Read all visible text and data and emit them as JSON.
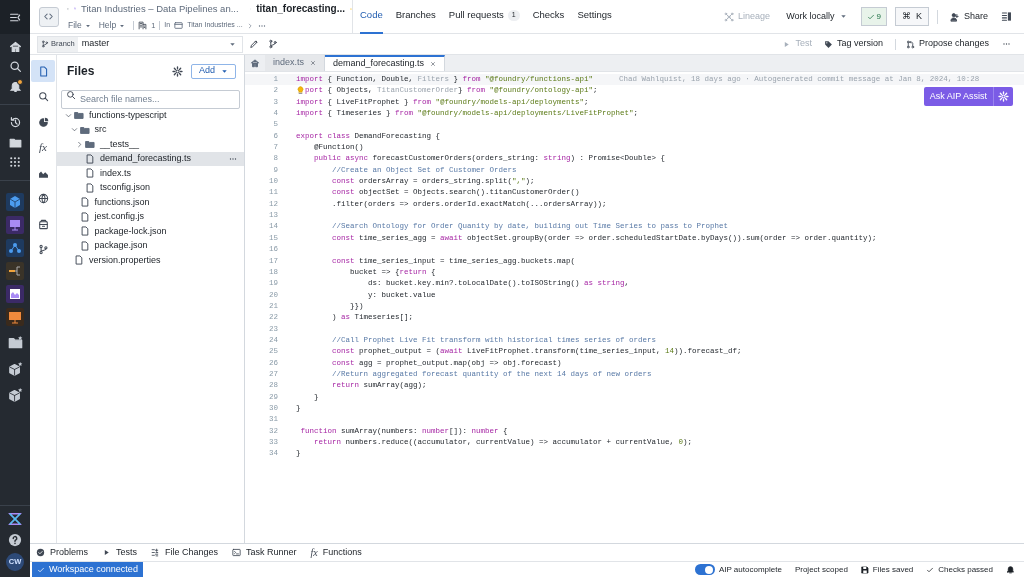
{
  "nav_rail": {
    "unread_notifications": true,
    "user_initials": "CW"
  },
  "header": {
    "breadcrumb_parent": "Titan Industries – Data Pipelines an...",
    "file_title": "titan_forecasting...",
    "starred": true,
    "menus": [
      "File",
      "Help"
    ],
    "resource_count": "1",
    "location_prefix": "In",
    "location": "Titan Industries ..."
  },
  "nav_tabs": [
    {
      "label": "Code",
      "selected": true
    },
    {
      "label": "Branches",
      "selected": false
    },
    {
      "label": "Pull requests",
      "count": "1",
      "selected": false
    },
    {
      "label": "Checks",
      "selected": false
    },
    {
      "label": "Settings",
      "selected": false
    }
  ],
  "header_actions": {
    "lineage": {
      "label": "Lineage",
      "disabled": true
    },
    "work_locally": "Work locally",
    "checks_count": "9",
    "shortcut": {
      "symbol": "⌘",
      "key": "K"
    },
    "share": "Share"
  },
  "branch": {
    "label": "Branch",
    "value": "master"
  },
  "toolbar": [
    {
      "kind": "test",
      "label": "Test",
      "disabled": true
    },
    {
      "kind": "tag",
      "label": "Tag version",
      "disabled": false
    },
    {
      "kind": "propose",
      "label": "Propose changes",
      "disabled": false
    }
  ],
  "side_icons": [
    {
      "kind": "files",
      "selected": true
    },
    {
      "kind": "search",
      "selected": false
    },
    {
      "kind": "pie",
      "selected": false
    },
    {
      "kind": "fx",
      "symbol": "fx",
      "selected": false
    },
    {
      "kind": "chart",
      "selected": false
    },
    {
      "kind": "globe",
      "selected": false
    },
    {
      "kind": "package",
      "selected": false
    },
    {
      "kind": "branch",
      "selected": false
    }
  ],
  "files": {
    "title": "Files",
    "add_button": "Add",
    "search_placeholder": "Search file names...",
    "tree": [
      {
        "name": "functions-typescript",
        "kind": "folder",
        "expanded": true,
        "selected": false,
        "children": [
          {
            "name": "src",
            "kind": "folder",
            "expanded": true,
            "selected": false,
            "children": [
              {
                "name": "__tests__",
                "kind": "folder",
                "expanded": false,
                "selected": false
              },
              {
                "name": "demand_forecasting.ts",
                "kind": "file",
                "selected": true
              },
              {
                "name": "index.ts",
                "kind": "file",
                "selected": false
              },
              {
                "name": "tsconfig.json",
                "kind": "file",
                "selected": false
              }
            ]
          },
          {
            "name": "functions.json",
            "kind": "file",
            "selected": false
          },
          {
            "name": "jest.config.js",
            "kind": "file",
            "selected": false
          },
          {
            "name": "package-lock.json",
            "kind": "file",
            "selected": false
          },
          {
            "name": "package.json",
            "kind": "file",
            "selected": false
          }
        ]
      },
      {
        "name": "version.properties",
        "kind": "file",
        "selected": false
      }
    ]
  },
  "editor": {
    "tabs": [
      {
        "label": "index.ts",
        "selected": false
      },
      {
        "label": "demand_forecasting.ts",
        "selected": true
      }
    ],
    "blame": "Chad Wahlquist, 18 days ago · Autogenerated commit message at Jan 8, 2024, 10:28",
    "ai_button": "Ask AIP Assist",
    "lines": [
      {
        "number": "1",
        "current": true,
        "hint": false,
        "tokens": [
          {
            "kind": "kw",
            "text": "import"
          },
          {
            "kind": "plain",
            "text": " { Function, Double, "
          },
          {
            "kind": "dim",
            "text": "Filters"
          },
          {
            "kind": "plain",
            "text": " } "
          },
          {
            "kind": "kw",
            "text": "from "
          },
          {
            "kind": "str",
            "text": "\"@foundry/functions-api\""
          }
        ]
      },
      {
        "number": "2",
        "current": false,
        "hint": true,
        "tokens": [
          {
            "kind": "kw",
            "text": "port"
          },
          {
            "kind": "plain",
            "text": " { Objects, "
          },
          {
            "kind": "dim",
            "text": "TitanCustomerOrder"
          },
          {
            "kind": "plain",
            "text": "} "
          },
          {
            "kind": "kw",
            "text": "from "
          },
          {
            "kind": "str",
            "text": "\"@foundry/ontology-api\""
          },
          {
            "kind": "plain",
            "text": ";"
          }
        ]
      },
      {
        "number": "3",
        "current": false,
        "hint": false,
        "tokens": [
          {
            "kind": "kw",
            "text": "import"
          },
          {
            "kind": "plain",
            "text": " { LiveFitProphet } "
          },
          {
            "kind": "kw",
            "text": "from "
          },
          {
            "kind": "str",
            "text": "\"@foundry/models-api/deployments\""
          },
          {
            "kind": "plain",
            "text": ";"
          }
        ]
      },
      {
        "number": "4",
        "current": false,
        "hint": false,
        "tokens": [
          {
            "kind": "kw",
            "text": "import"
          },
          {
            "kind": "plain",
            "text": " { Timeseries } "
          },
          {
            "kind": "kw",
            "text": "from "
          },
          {
            "kind": "str",
            "text": "\"@foundry/models-api/deployments/LiveFitProphet\""
          },
          {
            "kind": "plain",
            "text": ";"
          }
        ]
      },
      {
        "number": "5",
        "current": false,
        "hint": false
      },
      {
        "number": "6",
        "current": false,
        "hint": false,
        "tokens": [
          {
            "kind": "kw",
            "text": "export class"
          },
          {
            "kind": "plain",
            "text": " DemandForecasting {"
          }
        ]
      },
      {
        "number": "7",
        "current": false,
        "hint": false,
        "tokens": [
          {
            "kind": "plain",
            "text": "    @Function()"
          }
        ]
      },
      {
        "number": "8",
        "current": false,
        "hint": false,
        "tokens": [
          {
            "kind": "kw",
            "text": "    public async"
          },
          {
            "kind": "plain",
            "text": " forecastCustomerOrders(orders_string: "
          },
          {
            "kind": "kw",
            "text": "string"
          },
          {
            "kind": "plain",
            "text": ") : Promise<Double> {"
          }
        ]
      },
      {
        "number": "9",
        "current": false,
        "hint": false,
        "tokens": [
          {
            "kind": "cm",
            "text": "        //Create an Object Set of Customer Orders"
          }
        ]
      },
      {
        "number": "10",
        "current": false,
        "hint": false,
        "tokens": [
          {
            "kind": "kw",
            "text": "        const"
          },
          {
            "kind": "plain",
            "text": " ordersArray = orders_string.split("
          },
          {
            "kind": "str",
            "text": "\",\""
          },
          {
            "kind": "plain",
            "text": ");"
          }
        ]
      },
      {
        "number": "11",
        "current": false,
        "hint": false,
        "tokens": [
          {
            "kind": "kw",
            "text": "        const"
          },
          {
            "kind": "plain",
            "text": " objectSet = Objects.search().titanCustomerOrder()"
          }
        ]
      },
      {
        "number": "12",
        "current": false,
        "hint": false,
        "tokens": [
          {
            "kind": "plain",
            "text": "        .filter(orders => orders.orderId.exactMatch(...ordersArray));"
          }
        ]
      },
      {
        "number": "13",
        "current": false,
        "hint": false
      },
      {
        "number": "14",
        "current": false,
        "hint": false,
        "tokens": [
          {
            "kind": "cm",
            "text": "        //Search Ontology for Order Quanity by date, building out Time Series to pass to Prophet"
          }
        ]
      },
      {
        "number": "15",
        "current": false,
        "hint": false,
        "tokens": [
          {
            "kind": "kw",
            "text": "        const"
          },
          {
            "kind": "plain",
            "text": " time_series_agg = "
          },
          {
            "kind": "kw",
            "text": "await"
          },
          {
            "kind": "plain",
            "text": " objectSet.groupBy(order => order.scheduledStartDate.byDays()).sum(order => order.quantity);"
          }
        ]
      },
      {
        "number": "16",
        "current": false,
        "hint": false
      },
      {
        "number": "17",
        "current": false,
        "hint": false,
        "tokens": [
          {
            "kind": "kw",
            "text": "        const"
          },
          {
            "kind": "plain",
            "text": " time_series_input = time_series_agg.buckets.map("
          }
        ]
      },
      {
        "number": "18",
        "current": false,
        "hint": false,
        "tokens": [
          {
            "kind": "plain",
            "text": "            bucket => {"
          },
          {
            "kind": "kw",
            "text": "return"
          },
          {
            "kind": "plain",
            "text": " {"
          }
        ]
      },
      {
        "number": "19",
        "current": false,
        "hint": false,
        "tokens": [
          {
            "kind": "plain",
            "text": "                ds: bucket.key.min?.toLocalDate().toISOString() "
          },
          {
            "kind": "kw",
            "text": "as string"
          },
          {
            "kind": "plain",
            "text": ","
          }
        ]
      },
      {
        "number": "20",
        "current": false,
        "hint": false,
        "tokens": [
          {
            "kind": "plain",
            "text": "                y: bucket.value"
          }
        ]
      },
      {
        "number": "21",
        "current": false,
        "hint": false,
        "tokens": [
          {
            "kind": "plain",
            "text": "            }})"
          }
        ]
      },
      {
        "number": "22",
        "current": false,
        "hint": false,
        "tokens": [
          {
            "kind": "plain",
            "text": "        ) "
          },
          {
            "kind": "kw",
            "text": "as"
          },
          {
            "kind": "plain",
            "text": " Timeseries[];"
          }
        ]
      },
      {
        "number": "23",
        "current": false,
        "hint": false
      },
      {
        "number": "24",
        "current": false,
        "hint": false,
        "tokens": [
          {
            "kind": "cm",
            "text": "        //Call Prophet Live Fit transform with historical times series of orders"
          }
        ]
      },
      {
        "number": "25",
        "current": false,
        "hint": false,
        "tokens": [
          {
            "kind": "kw",
            "text": "        const"
          },
          {
            "kind": "plain",
            "text": " prophet_output = ("
          },
          {
            "kind": "kw",
            "text": "await"
          },
          {
            "kind": "plain",
            "text": " LiveFitProphet.transform(time_series_input, "
          },
          {
            "kind": "num",
            "text": "14"
          },
          {
            "kind": "plain",
            "text": ")).forecast_df;"
          }
        ]
      },
      {
        "number": "26",
        "current": false,
        "hint": false,
        "tokens": [
          {
            "kind": "kw",
            "text": "        const"
          },
          {
            "kind": "plain",
            "text": " agg = prophet_output.map(obj => obj.forecast)"
          }
        ]
      },
      {
        "number": "27",
        "current": false,
        "hint": false,
        "tokens": [
          {
            "kind": "cm",
            "text": "        //Return aggregated forecast quantity of the next 14 days of new orders"
          }
        ]
      },
      {
        "number": "28",
        "current": false,
        "hint": false,
        "tokens": [
          {
            "kind": "kw",
            "text": "        return"
          },
          {
            "kind": "plain",
            "text": " sumArray(agg);"
          }
        ]
      },
      {
        "number": "29",
        "current": false,
        "hint": false,
        "tokens": [
          {
            "kind": "plain",
            "text": "    }"
          }
        ]
      },
      {
        "number": "30",
        "current": false,
        "hint": false,
        "tokens": [
          {
            "kind": "plain",
            "text": "}"
          }
        ]
      },
      {
        "number": "31",
        "current": false,
        "hint": false
      },
      {
        "number": "32",
        "current": false,
        "hint": false,
        "tokens": [
          {
            "kind": "kw",
            "text": " function"
          },
          {
            "kind": "plain",
            "text": " sumArray(numbers: "
          },
          {
            "kind": "kw",
            "text": "number"
          },
          {
            "kind": "plain",
            "text": "[]): "
          },
          {
            "kind": "kw",
            "text": "number"
          },
          {
            "kind": "plain",
            "text": " {"
          }
        ]
      },
      {
        "number": "33",
        "current": false,
        "hint": false,
        "tokens": [
          {
            "kind": "kw",
            "text": "    return"
          },
          {
            "kind": "plain",
            "text": " numbers.reduce((accumulator, currentValue) => accumulator + currentValue, "
          },
          {
            "kind": "num",
            "text": "0"
          },
          {
            "kind": "plain",
            "text": ");"
          }
        ]
      },
      {
        "number": "34",
        "current": false,
        "hint": false,
        "tokens": [
          {
            "kind": "plain",
            "text": "}"
          }
        ]
      }
    ]
  },
  "bottom_tabs": [
    {
      "kind": "problems",
      "label": "Problems"
    },
    {
      "kind": "tests",
      "label": "Tests"
    },
    {
      "kind": "changes",
      "label": "File Changes"
    },
    {
      "kind": "runner",
      "label": "Task Runner"
    },
    {
      "kind": "functions",
      "symbol": "fx",
      "label": "Functions"
    }
  ],
  "status_bar": {
    "connection": "Workspace connected",
    "autocomplete": {
      "label": "AIP autocomplete",
      "on": true
    },
    "scope": "Project scoped",
    "saved": "Files saved",
    "checks": "Checks passed"
  }
}
